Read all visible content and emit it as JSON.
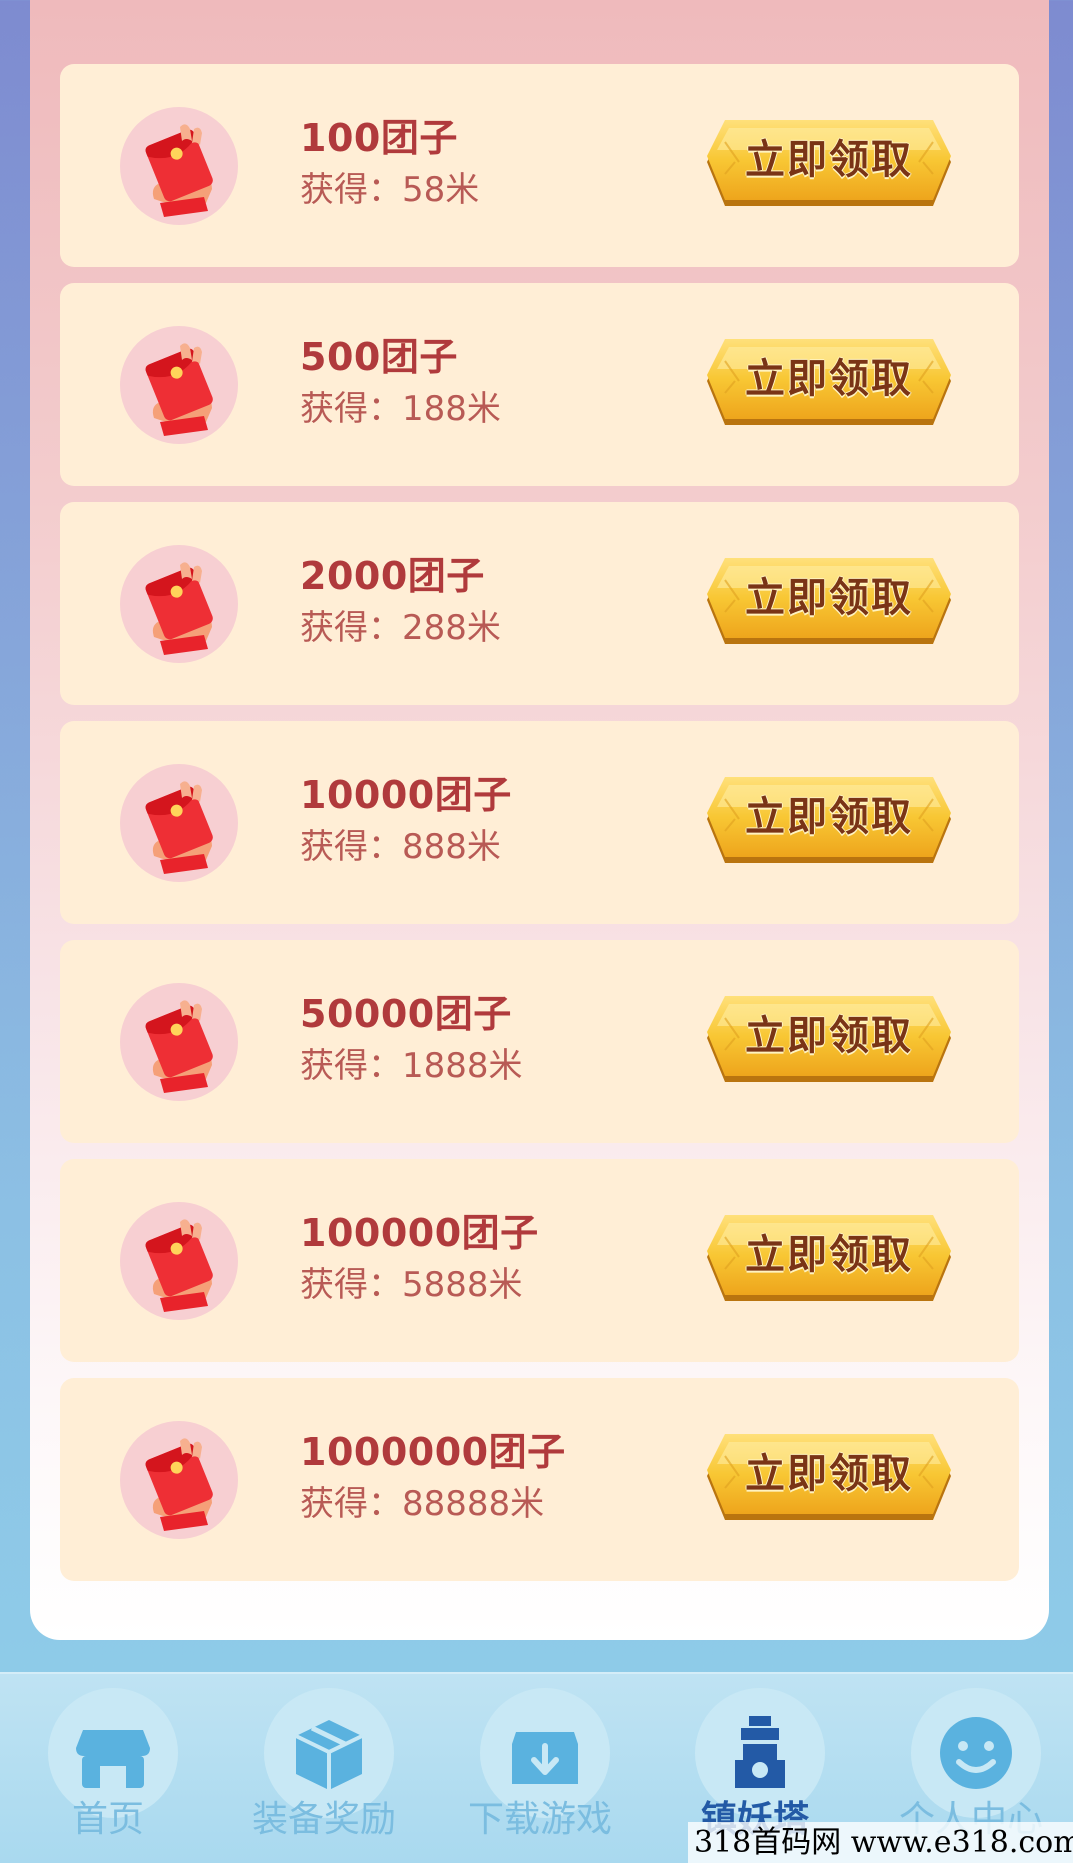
{
  "rewards": [
    {
      "amount": "100团子",
      "reward": "获得：58米",
      "button": "立即领取"
    },
    {
      "amount": "500团子",
      "reward": "获得：188米",
      "button": "立即领取"
    },
    {
      "amount": "2000团子",
      "reward": "获得：288米",
      "button": "立即领取"
    },
    {
      "amount": "10000团子",
      "reward": "获得：888米",
      "button": "立即领取"
    },
    {
      "amount": "50000团子",
      "reward": "获得：1888米",
      "button": "立即领取"
    },
    {
      "amount": "100000团子",
      "reward": "获得：5888米",
      "button": "立即领取"
    },
    {
      "amount": "1000000团子",
      "reward": "获得：88888米",
      "button": "立即领取"
    }
  ],
  "tabbar": {
    "tabs": [
      {
        "label": "首页",
        "icon": "store-icon",
        "active": false
      },
      {
        "label": "装备奖励",
        "icon": "box-icon",
        "active": false
      },
      {
        "label": "下载游戏",
        "icon": "download-icon",
        "active": false
      },
      {
        "label": "镇妖塔",
        "icon": "tower-icon",
        "active": true
      },
      {
        "label": "个人中心",
        "icon": "smiley-icon",
        "active": false
      }
    ]
  },
  "watermark": "318首码网 www.e318.com",
  "colors": {
    "card_bg": "#ffeed6",
    "amount_text": "#b03a3c",
    "button_gold": "#f6c12e",
    "tab_active": "#235aa6",
    "tab_inactive": "#7bbde0"
  }
}
